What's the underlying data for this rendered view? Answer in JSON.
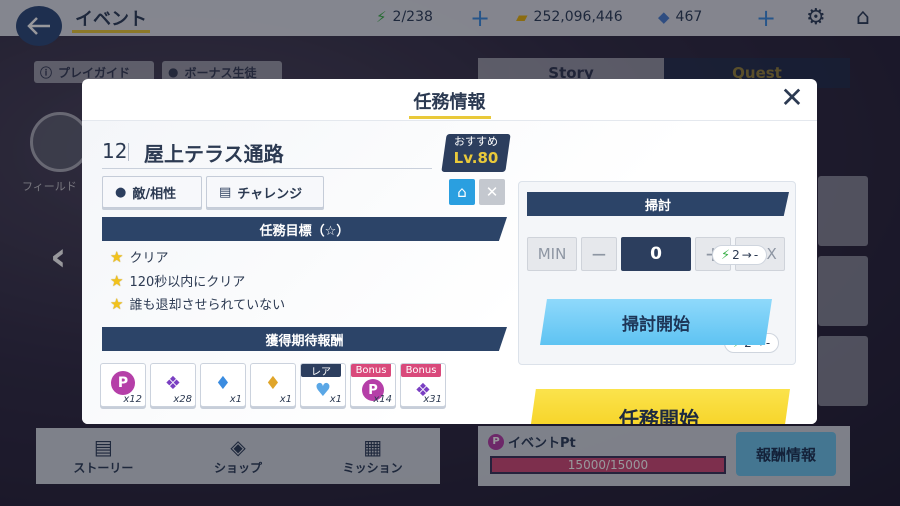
{
  "topbar": {
    "title": "イベント",
    "stamina": "2/238",
    "credits": "252,096,446",
    "gems": "467"
  },
  "background": {
    "play_guide": "プレイガイド",
    "bonus_students": "ボーナス生徒",
    "tab_story": "Story",
    "tab_quest": "Quest",
    "field_label": "フィールド"
  },
  "bottom_nav": {
    "story": "ストーリー",
    "shop": "ショップ",
    "mission": "ミッション"
  },
  "event_pt": {
    "label": "イベントPt",
    "progress": "15000/15000",
    "reward_info": "報酬情報"
  },
  "modal": {
    "title": "任務情報",
    "stage_number": "12",
    "stage_name": "屋上テラス通路",
    "recommended_label": "おすすめ",
    "recommended_level": "Lv.80",
    "enemy_button": "敵/相性",
    "challenge_button": "チャレンジ",
    "objectives_header": "任務目標（☆）",
    "objectives": [
      "クリア",
      "120秒以内にクリア",
      "誰も退却させられていない"
    ],
    "rewards_header": "獲得期待報酬",
    "rewards": [
      {
        "icon": "p-coin-icon",
        "qty": "x12",
        "tag": ""
      },
      {
        "icon": "purple-material-icon",
        "qty": "x28",
        "tag": ""
      },
      {
        "icon": "blue-crystal-icon",
        "qty": "x1",
        "tag": ""
      },
      {
        "icon": "gold-crystal-icon",
        "qty": "x1",
        "tag": ""
      },
      {
        "icon": "rare-crystal-icon",
        "qty": "x1",
        "tag": "レア"
      },
      {
        "icon": "p-coin-icon",
        "qty": "x14",
        "tag": "Bonus"
      },
      {
        "icon": "purple-material-icon",
        "qty": "x31",
        "tag": "Bonus"
      }
    ],
    "sweep": {
      "header": "掃討",
      "min": "MIN",
      "minus": "−",
      "count": "0",
      "plus": "+",
      "max": "MAX",
      "cost": "2",
      "cost_after": "-",
      "start": "掃討開始"
    },
    "mission": {
      "cost": "2",
      "cost_after": "-",
      "start": "任務開始"
    }
  },
  "colors": {
    "navy": "#2c4468",
    "accent_yellow": "#e9c93a",
    "sweep_blue": "#5ec3f2",
    "start_yellow": "#f5cd17"
  }
}
